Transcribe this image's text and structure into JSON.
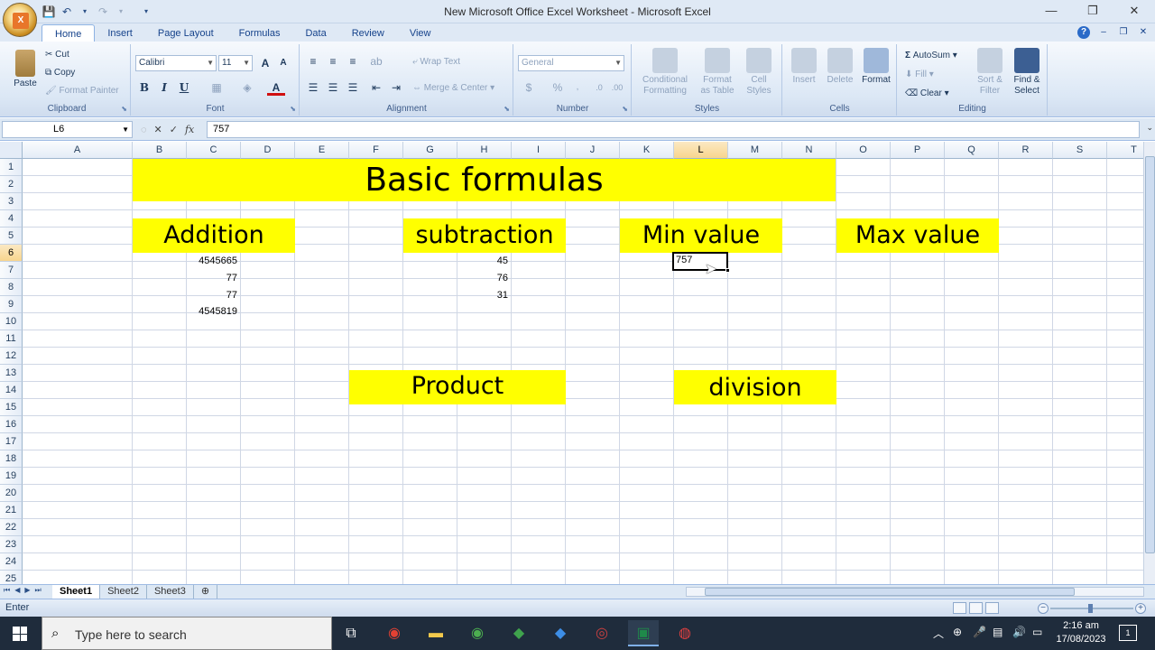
{
  "window": {
    "title": "New Microsoft Office Excel Worksheet - Microsoft Excel",
    "controls": [
      "—",
      "❐",
      "✕"
    ]
  },
  "office_button": {
    "logo": "X"
  },
  "tabs": [
    "Home",
    "Insert",
    "Page Layout",
    "Formulas",
    "Data",
    "Review",
    "View"
  ],
  "active_tab": "Home",
  "ribbon": {
    "clipboard": {
      "label": "Clipboard",
      "paste": "Paste",
      "cut": "Cut",
      "copy": "Copy",
      "format_painter": "Format Painter"
    },
    "font": {
      "label": "Font",
      "font_name": "Calibri",
      "font_size": "11",
      "grow": "A",
      "shrink": "A",
      "bold": "B",
      "italic": "I",
      "underline": "U"
    },
    "alignment": {
      "label": "Alignment",
      "wrap_text": "Wrap Text",
      "merge_center": "Merge & Center"
    },
    "number": {
      "label": "Number",
      "format": "General",
      "percent": "%"
    },
    "styles": {
      "label": "Styles",
      "conditional": "Conditional Formatting",
      "format_table": "Format as Table",
      "cell_styles": "Cell Styles"
    },
    "cells": {
      "label": "Cells",
      "insert": "Insert",
      "delete": "Delete",
      "format": "Format"
    },
    "editing": {
      "label": "Editing",
      "autosum": "AutoSum",
      "fill": "Fill",
      "clear": "Clear",
      "sort_filter": "Sort & Filter",
      "find_select": "Find & Select"
    }
  },
  "formula_bar": {
    "name_box": "L6",
    "fx": "fx",
    "value": "757"
  },
  "grid": {
    "columns": [
      "A",
      "B",
      "C",
      "D",
      "E",
      "F",
      "G",
      "H",
      "I",
      "J",
      "K",
      "L",
      "M",
      "N",
      "O",
      "P",
      "Q",
      "R",
      "S",
      "T"
    ],
    "rows": [
      "1",
      "2",
      "3",
      "4",
      "5",
      "6",
      "7",
      "8",
      "9",
      "10",
      "11",
      "12",
      "13",
      "14",
      "15",
      "16",
      "17",
      "18",
      "19",
      "20",
      "21",
      "22",
      "23",
      "24",
      "25"
    ],
    "selected_column": "L",
    "selected_row": "6"
  },
  "cells": {
    "title": "Basic formulas",
    "addition_header": "Addition",
    "subtraction_header": "subtraction",
    "min_header": "Min value",
    "max_header": "Max value",
    "product_header": "Product",
    "division_header": "division",
    "addition_values": [
      "4545665",
      "77",
      "77",
      "4545819"
    ],
    "subtraction_values": [
      "45",
      "76",
      "31"
    ],
    "active_value": "757"
  },
  "header_fill_color": "#ffff00",
  "sheets": [
    "Sheet1",
    "Sheet2",
    "Sheet3"
  ],
  "active_sheet": "Sheet1",
  "status": {
    "mode": "Enter"
  },
  "taskbar": {
    "search_placeholder": "Type here to search",
    "time": "2:16 am",
    "date": "17/08/2023",
    "notification_count": "1"
  }
}
